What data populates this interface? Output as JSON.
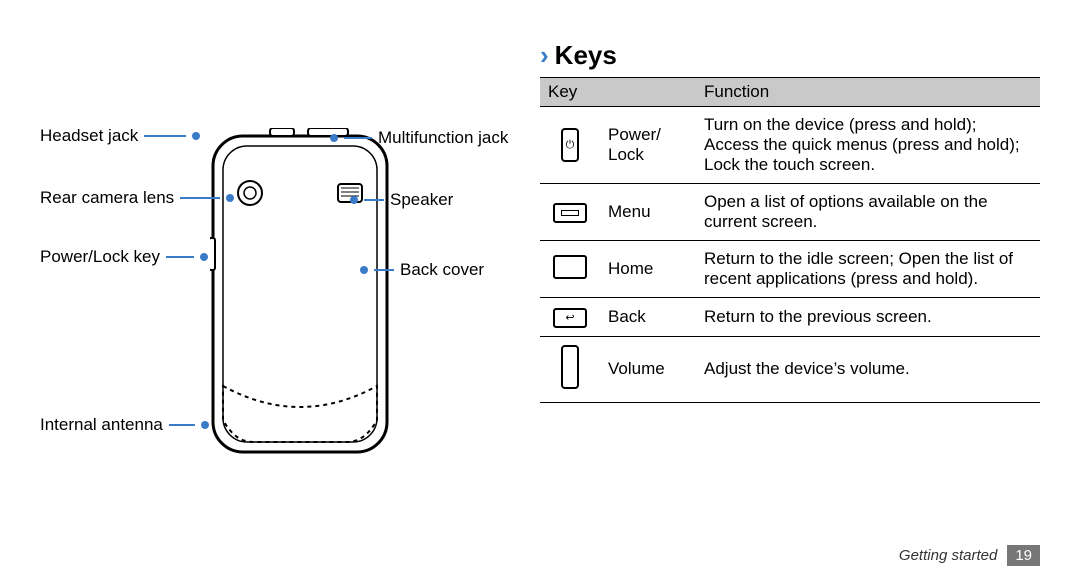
{
  "heading": {
    "title": "Keys"
  },
  "table": {
    "headers": {
      "key": "Key",
      "function": "Function"
    },
    "rows": {
      "power": {
        "name": "Power/\nLock",
        "function": "Turn on the device (press and hold); Access the quick menus (press and hold); Lock the touch screen."
      },
      "menu": {
        "name": "Menu",
        "function": "Open a list of options available on the current screen."
      },
      "home": {
        "name": "Home",
        "function": "Return to the idle screen; Open the list of recent applications (press and hold)."
      },
      "back": {
        "name": "Back",
        "function": "Return to the previous screen."
      },
      "volume": {
        "name": "Volume",
        "function": "Adjust the device’s volume."
      }
    }
  },
  "diagram": {
    "labels": {
      "headset_jack": "Headset jack",
      "rear_camera_lens": "Rear camera lens",
      "power_lock_key": "Power/Lock key",
      "internal_antenna": "Internal antenna",
      "multifunction_jack": "Multifunction jack",
      "speaker": "Speaker",
      "back_cover": "Back cover"
    }
  },
  "footer": {
    "section": "Getting started",
    "page": "19"
  }
}
